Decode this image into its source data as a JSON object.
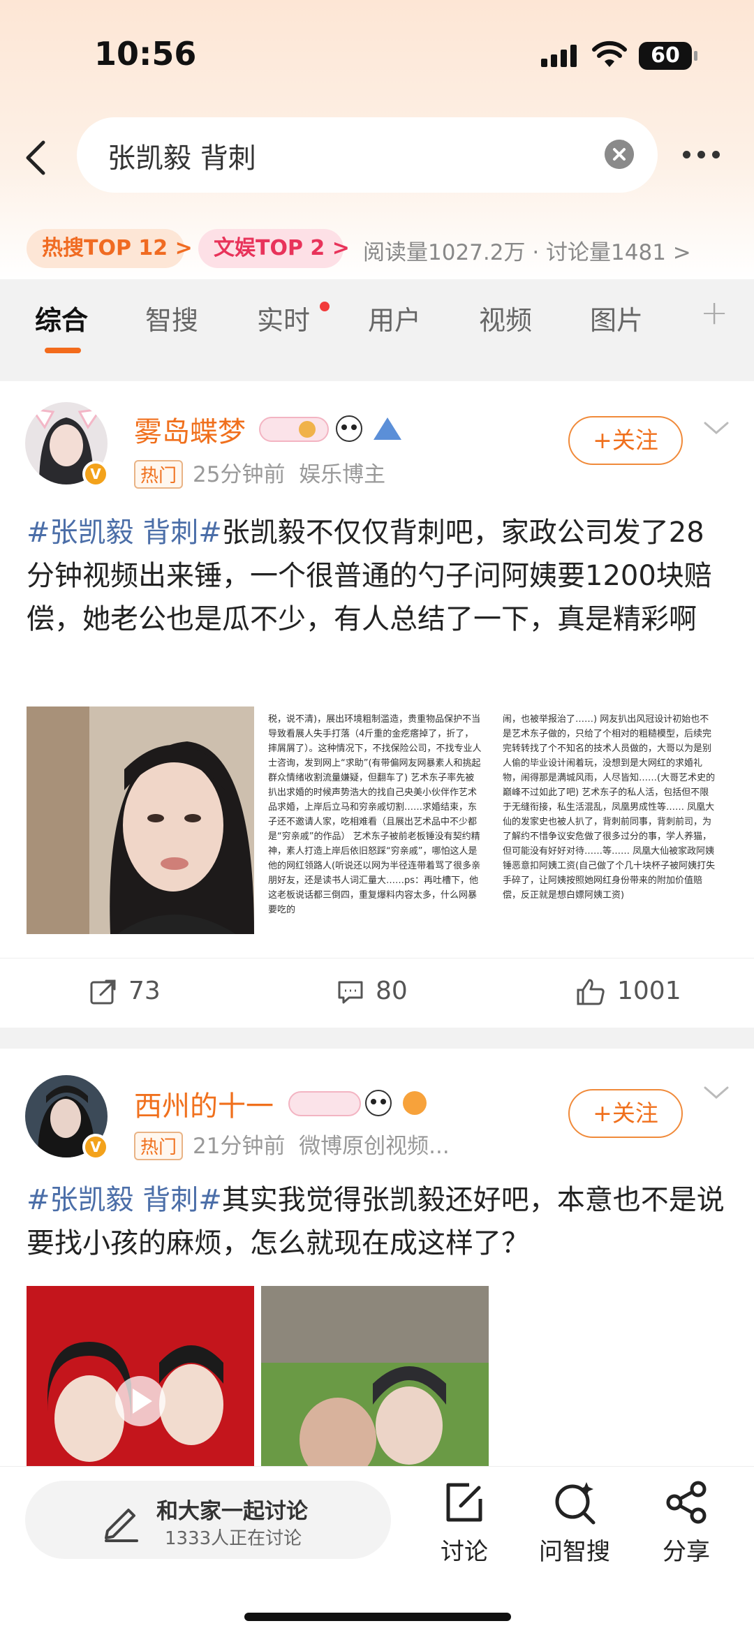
{
  "status_bar": {
    "time": "10:56",
    "battery": "60"
  },
  "search": {
    "query": "张凯毅 背刺"
  },
  "hot": {
    "pill1": "热搜TOP 12 >",
    "pill2": "文娱TOP 2 >",
    "stats": "阅读量1027.2万 · 讨论量1481 >"
  },
  "tabs": [
    "综合",
    "智搜",
    "实时",
    "用户",
    "视频",
    "图片"
  ],
  "posts": [
    {
      "username": "雾岛蝶梦",
      "hot_tag": "热门",
      "time": "25分钟前",
      "source": "娱乐博主",
      "follow": "+关注",
      "topic": "#张凯毅 背刺#",
      "text": "张凯毅不仅仅背刺吧，家政公司发了28分钟视频出来锤，一个很普通的勺子问阿姨要1200块赔偿，她老公也是瓜不少，有人总结了一下，真是精彩啊",
      "image2_text": "税，说不清)，展出环境粗制滥造，贵重物品保护不当导致看展人失手打落（4斤重的金疙瘩掉了，折了，摔屑屑了）。这种情况下，不找保险公司，不找专业人士咨询，发到网上“求助”(有带偏网友网暴素人和挑起群众情绪收割流量嫌疑，但翻车了) 艺术东子率先被扒出求婚的时候声势浩大的找自己央美小伙伴作艺术品求婚，上岸后立马和穷亲戚切割……求婚结束，东子还不邀请人家，吃相难看（且展出艺术品中不少都是“穷亲戚”的作品） 艺术东子被前老板锤没有契约精神，素人打造上岸后依旧怒踩“穷亲戚”，哪怕这人是他的网红领路人(听说还以网为半径连带着骂了很多亲朋好友，还是读书人词汇量大……ps：再吐槽下，他这老板说话都三倒四，重复爆料内容太多，什么网暴要吃的",
      "image3_text": "闹，也被举报治了……) 网友扒出风冠设计初始也不是艺术东子做的，只给了个相对的粗糙模型，后续完完转转找了个不知名的技术人员做的，大哥以为是别人偷的毕业设计闹着玩，没想到是大网红的求婚礼物，闹得那是满城风雨，人尽皆知……(大哥艺术史的巅峰不过如此了吧) 艺术东子的私人活，包括但不限于无缝衔接，私生活混乱，凤凰男成性等…… 凤凰大仙的发家史也被人扒了，背刺前同事，背刺前司，为了解约不惜争议安危做了很多过分的事，学人养猫，但可能没有好好对待……等…… 凤凰大仙被家政阿姨锤恶意扣阿姨工资(自己做了个几十块杯子被阿姨打失手碎了，让阿姨按照她网红身份带来的附加价值赔偿，反正就是想白嫖阿姨工资)",
      "reposts": "73",
      "comments": "80",
      "likes": "1001"
    },
    {
      "username": "西州的十一",
      "hot_tag": "热门",
      "time": "21分钟前",
      "source": "微博原创视频...",
      "follow": "+关注",
      "topic": "#张凯毅 背刺#",
      "text": "其实我觉得张凯毅还好吧，本意也不是说要找小孩的麻烦，怎么就现在成这样了？"
    }
  ],
  "bottom": {
    "discuss_title": "和大家一起讨论",
    "discuss_sub": "1333人正在讨论",
    "btn_discuss": "讨论",
    "btn_ai": "问智搜",
    "btn_share": "分享"
  },
  "colors": {
    "accent": "#f36b1c",
    "topic": "#4b6ea8",
    "username": "#f0701d"
  }
}
